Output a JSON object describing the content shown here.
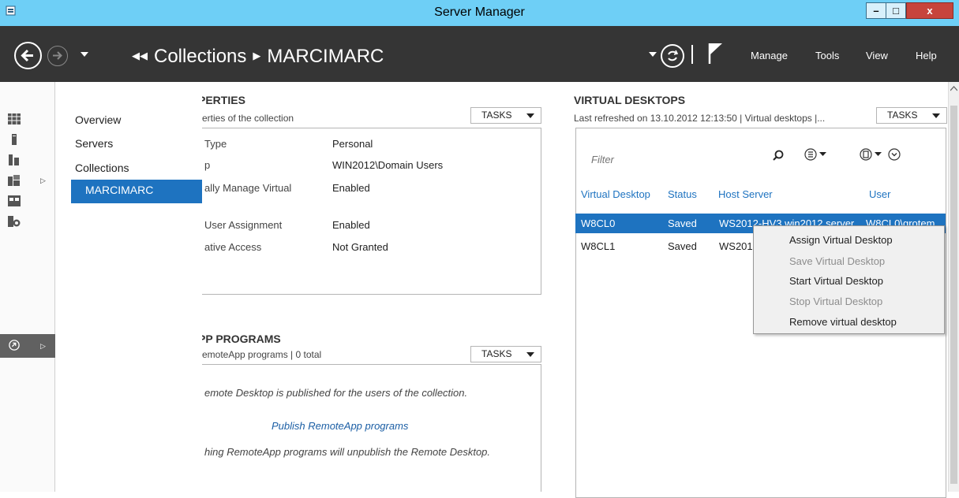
{
  "window": {
    "title": "Server Manager",
    "minimize": "–",
    "maximize": "□",
    "close": "x"
  },
  "header": {
    "breadcrumb": [
      "Collections",
      "MARCIMARC"
    ],
    "menu": [
      "Manage",
      "Tools",
      "View",
      "Help"
    ]
  },
  "tree": {
    "items": [
      "Overview",
      "Servers",
      "Collections"
    ],
    "selected": "MARCIMARC"
  },
  "properties": {
    "title": "PERTIES",
    "subtitle": "erties of the collection",
    "tasks": "TASKS",
    "rows": [
      {
        "label": "Type",
        "value": "Personal"
      },
      {
        "label": "p",
        "value": "WIN2012\\Domain Users"
      },
      {
        "label": "ally Manage Virtual",
        "value": "Enabled"
      },
      {
        "label": "User Assignment",
        "value": "Enabled"
      },
      {
        "label": "ative Access",
        "value": "Not Granted"
      }
    ]
  },
  "remoteapp": {
    "title": "PP PROGRAMS",
    "subtitle": "emoteApp programs | 0 total",
    "tasks": "TASKS",
    "message1": "emote Desktop is published for the users of the collection.",
    "link": "Publish RemoteApp programs",
    "message2": "hing RemoteApp programs will unpublish the Remote Desktop."
  },
  "virtual_desktops": {
    "title": "VIRTUAL DESKTOPS",
    "subtitle": "Last refreshed on 13.10.2012 12:13:50 | Virtual desktops |...",
    "tasks": "TASKS",
    "filter_placeholder": "Filter",
    "columns": [
      "Virtual Desktop",
      "Status",
      "Host Server",
      "User"
    ],
    "rows": [
      {
        "desktop": "W8CL0",
        "status": "Saved",
        "host": "WS2012-HV3.win2012.server",
        "user": "W8CL0\\grotem"
      },
      {
        "desktop": "W8CL1",
        "status": "Saved",
        "host": "WS201",
        "user": ""
      }
    ]
  },
  "context_menu": {
    "items": [
      {
        "label": "Assign Virtual Desktop",
        "enabled": true
      },
      {
        "label": "Save Virtual Desktop",
        "enabled": false
      },
      {
        "label": "Start Virtual Desktop",
        "enabled": true
      },
      {
        "label": "Stop Virtual Desktop",
        "enabled": false
      },
      {
        "label": "Remove virtual desktop",
        "enabled": true
      }
    ]
  },
  "colors": {
    "accent": "#1e73c0",
    "header_bg": "#353535",
    "titlebar_bg": "#6ecff6",
    "close_red": "#c7443c"
  }
}
